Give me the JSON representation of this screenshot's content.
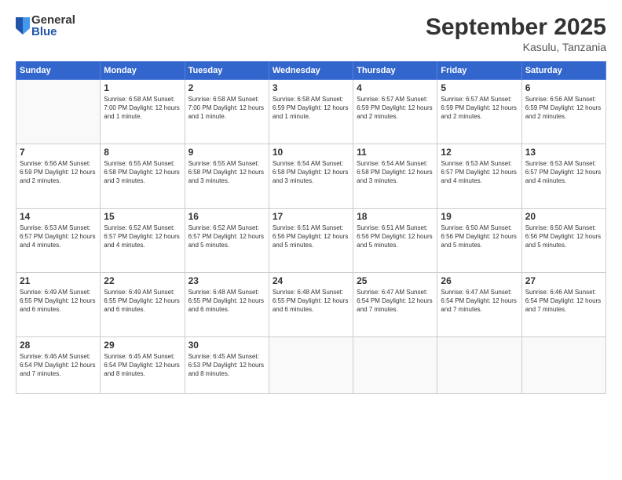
{
  "logo": {
    "general": "General",
    "blue": "Blue"
  },
  "title": "September 2025",
  "location": "Kasulu, Tanzania",
  "days_header": [
    "Sunday",
    "Monday",
    "Tuesday",
    "Wednesday",
    "Thursday",
    "Friday",
    "Saturday"
  ],
  "weeks": [
    [
      {
        "day": "",
        "info": ""
      },
      {
        "day": "1",
        "info": "Sunrise: 6:58 AM\nSunset: 7:00 PM\nDaylight: 12 hours\nand 1 minute."
      },
      {
        "day": "2",
        "info": "Sunrise: 6:58 AM\nSunset: 7:00 PM\nDaylight: 12 hours\nand 1 minute."
      },
      {
        "day": "3",
        "info": "Sunrise: 6:58 AM\nSunset: 6:59 PM\nDaylight: 12 hours\nand 1 minute."
      },
      {
        "day": "4",
        "info": "Sunrise: 6:57 AM\nSunset: 6:59 PM\nDaylight: 12 hours\nand 2 minutes."
      },
      {
        "day": "5",
        "info": "Sunrise: 6:57 AM\nSunset: 6:59 PM\nDaylight: 12 hours\nand 2 minutes."
      },
      {
        "day": "6",
        "info": "Sunrise: 6:56 AM\nSunset: 6:59 PM\nDaylight: 12 hours\nand 2 minutes."
      }
    ],
    [
      {
        "day": "7",
        "info": "Sunrise: 6:56 AM\nSunset: 6:59 PM\nDaylight: 12 hours\nand 2 minutes."
      },
      {
        "day": "8",
        "info": "Sunrise: 6:55 AM\nSunset: 6:58 PM\nDaylight: 12 hours\nand 3 minutes."
      },
      {
        "day": "9",
        "info": "Sunrise: 6:55 AM\nSunset: 6:58 PM\nDaylight: 12 hours\nand 3 minutes."
      },
      {
        "day": "10",
        "info": "Sunrise: 6:54 AM\nSunset: 6:58 PM\nDaylight: 12 hours\nand 3 minutes."
      },
      {
        "day": "11",
        "info": "Sunrise: 6:54 AM\nSunset: 6:58 PM\nDaylight: 12 hours\nand 3 minutes."
      },
      {
        "day": "12",
        "info": "Sunrise: 6:53 AM\nSunset: 6:57 PM\nDaylight: 12 hours\nand 4 minutes."
      },
      {
        "day": "13",
        "info": "Sunrise: 6:53 AM\nSunset: 6:57 PM\nDaylight: 12 hours\nand 4 minutes."
      }
    ],
    [
      {
        "day": "14",
        "info": "Sunrise: 6:53 AM\nSunset: 6:57 PM\nDaylight: 12 hours\nand 4 minutes."
      },
      {
        "day": "15",
        "info": "Sunrise: 6:52 AM\nSunset: 6:57 PM\nDaylight: 12 hours\nand 4 minutes."
      },
      {
        "day": "16",
        "info": "Sunrise: 6:52 AM\nSunset: 6:57 PM\nDaylight: 12 hours\nand 5 minutes."
      },
      {
        "day": "17",
        "info": "Sunrise: 6:51 AM\nSunset: 6:56 PM\nDaylight: 12 hours\nand 5 minutes."
      },
      {
        "day": "18",
        "info": "Sunrise: 6:51 AM\nSunset: 6:56 PM\nDaylight: 12 hours\nand 5 minutes."
      },
      {
        "day": "19",
        "info": "Sunrise: 6:50 AM\nSunset: 6:56 PM\nDaylight: 12 hours\nand 5 minutes."
      },
      {
        "day": "20",
        "info": "Sunrise: 6:50 AM\nSunset: 6:56 PM\nDaylight: 12 hours\nand 5 minutes."
      }
    ],
    [
      {
        "day": "21",
        "info": "Sunrise: 6:49 AM\nSunset: 6:55 PM\nDaylight: 12 hours\nand 6 minutes."
      },
      {
        "day": "22",
        "info": "Sunrise: 6:49 AM\nSunset: 6:55 PM\nDaylight: 12 hours\nand 6 minutes."
      },
      {
        "day": "23",
        "info": "Sunrise: 6:48 AM\nSunset: 6:55 PM\nDaylight: 12 hours\nand 6 minutes."
      },
      {
        "day": "24",
        "info": "Sunrise: 6:48 AM\nSunset: 6:55 PM\nDaylight: 12 hours\nand 6 minutes."
      },
      {
        "day": "25",
        "info": "Sunrise: 6:47 AM\nSunset: 6:54 PM\nDaylight: 12 hours\nand 7 minutes."
      },
      {
        "day": "26",
        "info": "Sunrise: 6:47 AM\nSunset: 6:54 PM\nDaylight: 12 hours\nand 7 minutes."
      },
      {
        "day": "27",
        "info": "Sunrise: 6:46 AM\nSunset: 6:54 PM\nDaylight: 12 hours\nand 7 minutes."
      }
    ],
    [
      {
        "day": "28",
        "info": "Sunrise: 6:46 AM\nSunset: 6:54 PM\nDaylight: 12 hours\nand 7 minutes."
      },
      {
        "day": "29",
        "info": "Sunrise: 6:45 AM\nSunset: 6:54 PM\nDaylight: 12 hours\nand 8 minutes."
      },
      {
        "day": "30",
        "info": "Sunrise: 6:45 AM\nSunset: 6:53 PM\nDaylight: 12 hours\nand 8 minutes."
      },
      {
        "day": "",
        "info": ""
      },
      {
        "day": "",
        "info": ""
      },
      {
        "day": "",
        "info": ""
      },
      {
        "day": "",
        "info": ""
      }
    ]
  ]
}
